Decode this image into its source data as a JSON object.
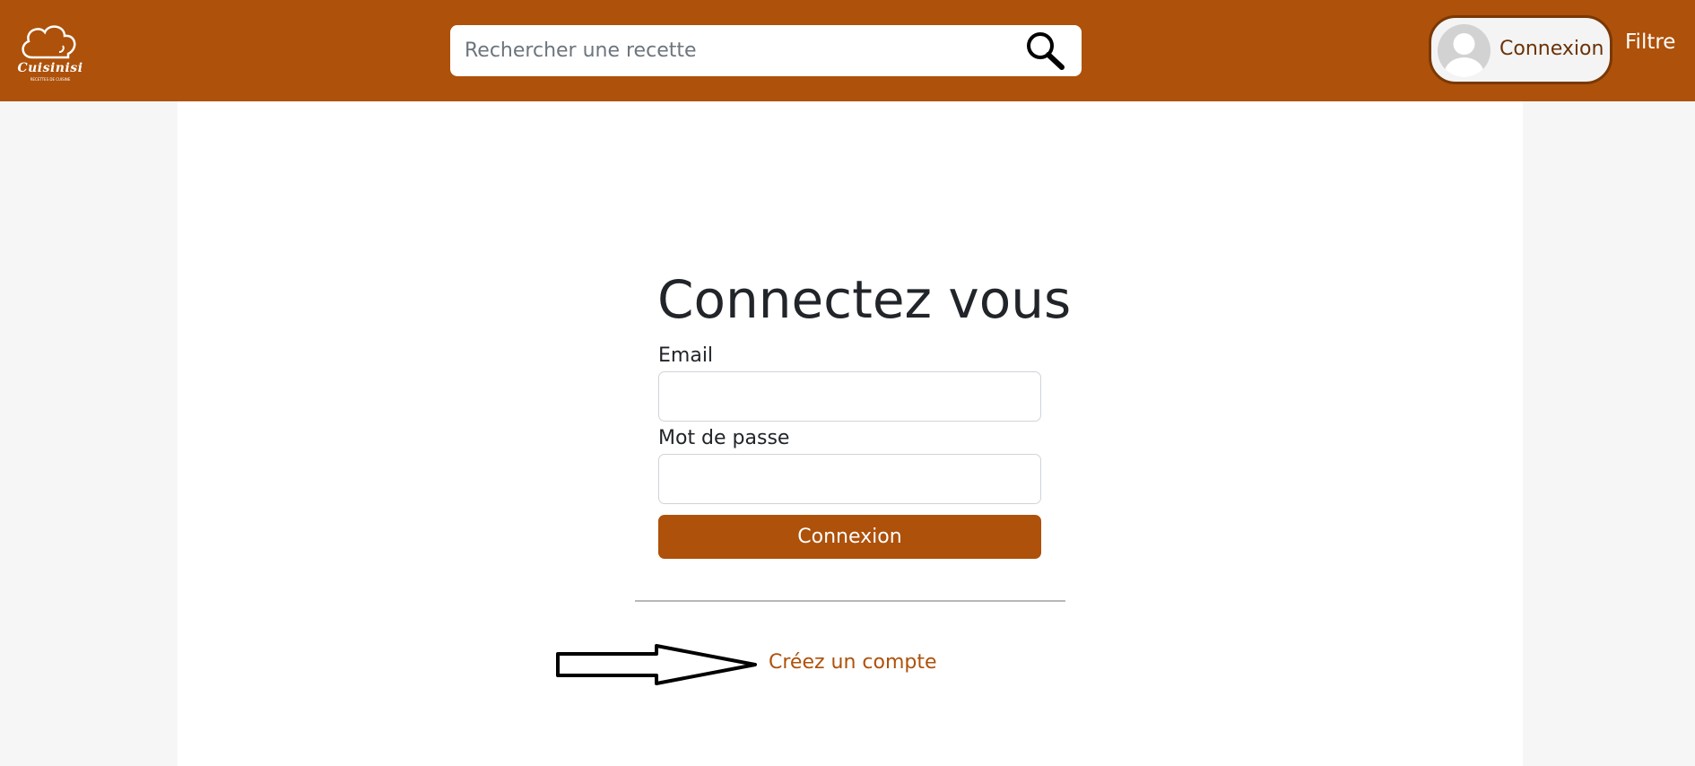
{
  "header": {
    "logo": {
      "name": "Cuisinisi",
      "tagline": "RECETTES DE CUISINE"
    },
    "search": {
      "placeholder": "Rechercher une recette",
      "value": "",
      "icon": "search-icon"
    },
    "user_button": {
      "label": "Connexion",
      "icon": "user-avatar-icon"
    },
    "filter_label": "Filtre"
  },
  "login_form": {
    "title": "Connectez vous",
    "email_label": "Email",
    "email_value": "",
    "password_label": "Mot de passe",
    "password_value": "",
    "submit_label": "Connexion",
    "create_account_label": "Créez un compte",
    "arrow_icon": "arrow-right-icon"
  },
  "colors": {
    "brand": "#ae510a",
    "page_background": "#f6f6f6",
    "panel_background": "#ffffff",
    "title_text": "#212529"
  }
}
